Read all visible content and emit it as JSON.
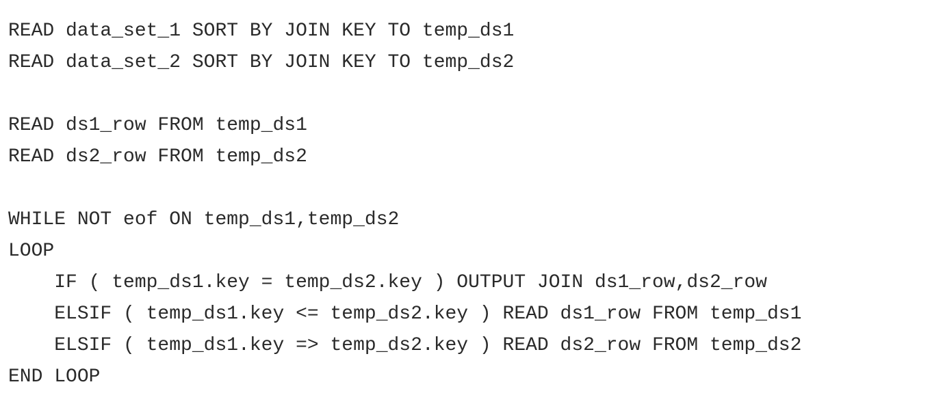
{
  "code": {
    "lines": [
      "READ data_set_1 SORT BY JOIN KEY TO temp_ds1",
      "READ data_set_2 SORT BY JOIN KEY TO temp_ds2",
      "",
      "READ ds1_row FROM temp_ds1",
      "READ ds2_row FROM temp_ds2",
      "",
      "WHILE NOT eof ON temp_ds1,temp_ds2",
      "LOOP",
      "    IF ( temp_ds1.key = temp_ds2.key ) OUTPUT JOIN ds1_row,ds2_row",
      "    ELSIF ( temp_ds1.key <= temp_ds2.key ) READ ds1_row FROM temp_ds1",
      "    ELSIF ( temp_ds1.key => temp_ds2.key ) READ ds2_row FROM temp_ds2",
      "END LOOP"
    ]
  }
}
